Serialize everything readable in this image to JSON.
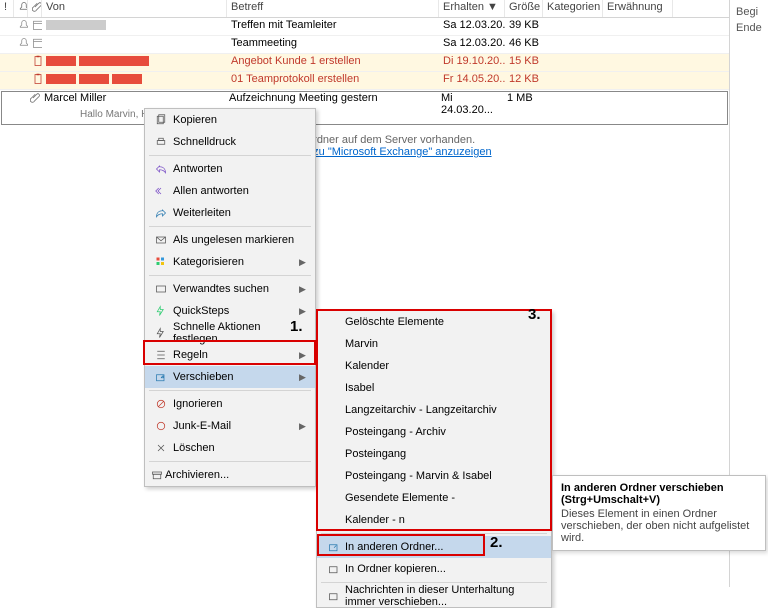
{
  "headers": {
    "von": "Von",
    "betreff": "Betreff",
    "erhalten": "Erhalten",
    "groesse": "Größe",
    "kategorien": "Kategorien",
    "erwaehnung": "Erwähnung"
  },
  "rows": [
    {
      "von": "",
      "betreff": "Treffen mit Teamleiter",
      "erhalten": "Sa 12.03.20...",
      "groesse": "39 KB",
      "highlight": false
    },
    {
      "von": "",
      "betreff": "Teammeeting",
      "erhalten": "Sa 12.03.20...",
      "groesse": "46 KB",
      "highlight": false
    },
    {
      "von": "",
      "betreff": "Angebot Kunde 1 erstellen",
      "erhalten": "Di 19.10.20...",
      "groesse": "15 KB",
      "highlight": true
    },
    {
      "von": "",
      "betreff": "01 Teamprotokoll erstellen",
      "erhalten": "Fr 14.05.20...",
      "groesse": "12 KB",
      "highlight": true
    }
  ],
  "tall_row": {
    "von": "Marcel Miller",
    "betreff": "Aufzeichnung Meeting gestern",
    "erhalten": "Mi 24.03.20...",
    "groesse": "1 MB",
    "preview": "Hallo Marvin,  Hall"
  },
  "info": {
    "line1_suffix": "ente in diesem Ordner auf dem Server vorhanden.",
    "link_text": "re Informationen zu \"Microsoft Exchange\" anzuzeigen"
  },
  "context_menu": {
    "kopieren": "Kopieren",
    "schnelldruck": "Schnelldruck",
    "antworten": "Antworten",
    "allen_antworten": "Allen antworten",
    "weiterleiten": "Weiterleiten",
    "als_ungelesen": "Als ungelesen markieren",
    "kategorisieren": "Kategorisieren",
    "verwandtes_suchen": "Verwandtes suchen",
    "quicksteps": "QuickSteps",
    "schnelle_aktionen": "Schnelle Aktionen festlegen...",
    "regeln": "Regeln",
    "verschieben": "Verschieben",
    "ignorieren": "Ignorieren",
    "junk": "Junk-E-Mail",
    "loeschen": "Löschen",
    "archivieren": "Archivieren..."
  },
  "submenu": {
    "geloeschte": "Gelöschte Elemente",
    "marvin": "Marvin",
    "kalender": "Kalender",
    "isabel": "Isabel",
    "langzeit": "Langzeitarchiv - Langzeitarchiv",
    "posteingang_archiv": "Posteingang - Archiv",
    "posteingang": "Posteingang",
    "posteingang_mi": "Posteingang - Marvin & Isabel",
    "gesendete": "Gesendete Elemente - ",
    "kalender_n": "Kalender - n",
    "in_anderen_ordner": "In anderen Ordner...",
    "in_ordner_kopieren": "In Ordner kopieren...",
    "nachrichten_verschieben": "Nachrichten in dieser Unterhaltung immer verschieben..."
  },
  "tooltip": {
    "title": "In anderen Ordner verschieben (Strg+Umschalt+V)",
    "body": "Dieses Element in einen Ordner verschieben, der oben nicht aufgelistet wird."
  },
  "annotations": {
    "a1": "1.",
    "a2": "2.",
    "a3": "3."
  },
  "side": {
    "l1": "Begi",
    "l2": "Ende"
  }
}
